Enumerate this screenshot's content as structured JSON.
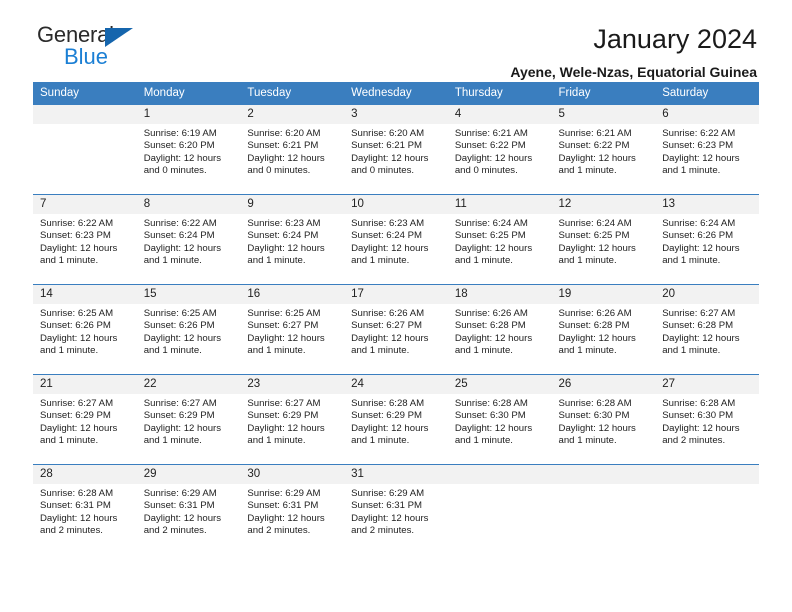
{
  "brand": {
    "name_top": "General",
    "name_bottom": "Blue",
    "triangle_color": "#1565ad",
    "blue_color": "#1b7fd4"
  },
  "header": {
    "title": "January 2024",
    "subtitle": "Ayene, Wele-Nzas, Equatorial Guinea"
  },
  "theme": {
    "header_row_bg": "#3a7ebf",
    "daynum_bg": "#f2f2f2",
    "grid_line": "#3a7ebf",
    "text": "#222222"
  },
  "weekdays": [
    "Sunday",
    "Monday",
    "Tuesday",
    "Wednesday",
    "Thursday",
    "Friday",
    "Saturday"
  ],
  "weeks": [
    [
      {
        "day": "",
        "sunrise": "",
        "sunset": "",
        "daylight1": "",
        "daylight2": ""
      },
      {
        "day": "1",
        "sunrise": "Sunrise: 6:19 AM",
        "sunset": "Sunset: 6:20 PM",
        "daylight1": "Daylight: 12 hours",
        "daylight2": "and 0 minutes."
      },
      {
        "day": "2",
        "sunrise": "Sunrise: 6:20 AM",
        "sunset": "Sunset: 6:21 PM",
        "daylight1": "Daylight: 12 hours",
        "daylight2": "and 0 minutes."
      },
      {
        "day": "3",
        "sunrise": "Sunrise: 6:20 AM",
        "sunset": "Sunset: 6:21 PM",
        "daylight1": "Daylight: 12 hours",
        "daylight2": "and 0 minutes."
      },
      {
        "day": "4",
        "sunrise": "Sunrise: 6:21 AM",
        "sunset": "Sunset: 6:22 PM",
        "daylight1": "Daylight: 12 hours",
        "daylight2": "and 0 minutes."
      },
      {
        "day": "5",
        "sunrise": "Sunrise: 6:21 AM",
        "sunset": "Sunset: 6:22 PM",
        "daylight1": "Daylight: 12 hours",
        "daylight2": "and 1 minute."
      },
      {
        "day": "6",
        "sunrise": "Sunrise: 6:22 AM",
        "sunset": "Sunset: 6:23 PM",
        "daylight1": "Daylight: 12 hours",
        "daylight2": "and 1 minute."
      }
    ],
    [
      {
        "day": "7",
        "sunrise": "Sunrise: 6:22 AM",
        "sunset": "Sunset: 6:23 PM",
        "daylight1": "Daylight: 12 hours",
        "daylight2": "and 1 minute."
      },
      {
        "day": "8",
        "sunrise": "Sunrise: 6:22 AM",
        "sunset": "Sunset: 6:24 PM",
        "daylight1": "Daylight: 12 hours",
        "daylight2": "and 1 minute."
      },
      {
        "day": "9",
        "sunrise": "Sunrise: 6:23 AM",
        "sunset": "Sunset: 6:24 PM",
        "daylight1": "Daylight: 12 hours",
        "daylight2": "and 1 minute."
      },
      {
        "day": "10",
        "sunrise": "Sunrise: 6:23 AM",
        "sunset": "Sunset: 6:24 PM",
        "daylight1": "Daylight: 12 hours",
        "daylight2": "and 1 minute."
      },
      {
        "day": "11",
        "sunrise": "Sunrise: 6:24 AM",
        "sunset": "Sunset: 6:25 PM",
        "daylight1": "Daylight: 12 hours",
        "daylight2": "and 1 minute."
      },
      {
        "day": "12",
        "sunrise": "Sunrise: 6:24 AM",
        "sunset": "Sunset: 6:25 PM",
        "daylight1": "Daylight: 12 hours",
        "daylight2": "and 1 minute."
      },
      {
        "day": "13",
        "sunrise": "Sunrise: 6:24 AM",
        "sunset": "Sunset: 6:26 PM",
        "daylight1": "Daylight: 12 hours",
        "daylight2": "and 1 minute."
      }
    ],
    [
      {
        "day": "14",
        "sunrise": "Sunrise: 6:25 AM",
        "sunset": "Sunset: 6:26 PM",
        "daylight1": "Daylight: 12 hours",
        "daylight2": "and 1 minute."
      },
      {
        "day": "15",
        "sunrise": "Sunrise: 6:25 AM",
        "sunset": "Sunset: 6:26 PM",
        "daylight1": "Daylight: 12 hours",
        "daylight2": "and 1 minute."
      },
      {
        "day": "16",
        "sunrise": "Sunrise: 6:25 AM",
        "sunset": "Sunset: 6:27 PM",
        "daylight1": "Daylight: 12 hours",
        "daylight2": "and 1 minute."
      },
      {
        "day": "17",
        "sunrise": "Sunrise: 6:26 AM",
        "sunset": "Sunset: 6:27 PM",
        "daylight1": "Daylight: 12 hours",
        "daylight2": "and 1 minute."
      },
      {
        "day": "18",
        "sunrise": "Sunrise: 6:26 AM",
        "sunset": "Sunset: 6:28 PM",
        "daylight1": "Daylight: 12 hours",
        "daylight2": "and 1 minute."
      },
      {
        "day": "19",
        "sunrise": "Sunrise: 6:26 AM",
        "sunset": "Sunset: 6:28 PM",
        "daylight1": "Daylight: 12 hours",
        "daylight2": "and 1 minute."
      },
      {
        "day": "20",
        "sunrise": "Sunrise: 6:27 AM",
        "sunset": "Sunset: 6:28 PM",
        "daylight1": "Daylight: 12 hours",
        "daylight2": "and 1 minute."
      }
    ],
    [
      {
        "day": "21",
        "sunrise": "Sunrise: 6:27 AM",
        "sunset": "Sunset: 6:29 PM",
        "daylight1": "Daylight: 12 hours",
        "daylight2": "and 1 minute."
      },
      {
        "day": "22",
        "sunrise": "Sunrise: 6:27 AM",
        "sunset": "Sunset: 6:29 PM",
        "daylight1": "Daylight: 12 hours",
        "daylight2": "and 1 minute."
      },
      {
        "day": "23",
        "sunrise": "Sunrise: 6:27 AM",
        "sunset": "Sunset: 6:29 PM",
        "daylight1": "Daylight: 12 hours",
        "daylight2": "and 1 minute."
      },
      {
        "day": "24",
        "sunrise": "Sunrise: 6:28 AM",
        "sunset": "Sunset: 6:29 PM",
        "daylight1": "Daylight: 12 hours",
        "daylight2": "and 1 minute."
      },
      {
        "day": "25",
        "sunrise": "Sunrise: 6:28 AM",
        "sunset": "Sunset: 6:30 PM",
        "daylight1": "Daylight: 12 hours",
        "daylight2": "and 1 minute."
      },
      {
        "day": "26",
        "sunrise": "Sunrise: 6:28 AM",
        "sunset": "Sunset: 6:30 PM",
        "daylight1": "Daylight: 12 hours",
        "daylight2": "and 1 minute."
      },
      {
        "day": "27",
        "sunrise": "Sunrise: 6:28 AM",
        "sunset": "Sunset: 6:30 PM",
        "daylight1": "Daylight: 12 hours",
        "daylight2": "and 2 minutes."
      }
    ],
    [
      {
        "day": "28",
        "sunrise": "Sunrise: 6:28 AM",
        "sunset": "Sunset: 6:31 PM",
        "daylight1": "Daylight: 12 hours",
        "daylight2": "and 2 minutes."
      },
      {
        "day": "29",
        "sunrise": "Sunrise: 6:29 AM",
        "sunset": "Sunset: 6:31 PM",
        "daylight1": "Daylight: 12 hours",
        "daylight2": "and 2 minutes."
      },
      {
        "day": "30",
        "sunrise": "Sunrise: 6:29 AM",
        "sunset": "Sunset: 6:31 PM",
        "daylight1": "Daylight: 12 hours",
        "daylight2": "and 2 minutes."
      },
      {
        "day": "31",
        "sunrise": "Sunrise: 6:29 AM",
        "sunset": "Sunset: 6:31 PM",
        "daylight1": "Daylight: 12 hours",
        "daylight2": "and 2 minutes."
      },
      {
        "day": "",
        "sunrise": "",
        "sunset": "",
        "daylight1": "",
        "daylight2": ""
      },
      {
        "day": "",
        "sunrise": "",
        "sunset": "",
        "daylight1": "",
        "daylight2": ""
      },
      {
        "day": "",
        "sunrise": "",
        "sunset": "",
        "daylight1": "",
        "daylight2": ""
      }
    ]
  ]
}
